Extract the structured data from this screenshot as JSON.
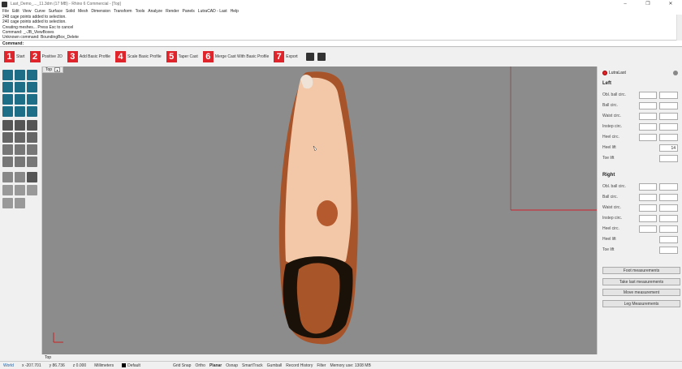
{
  "window": {
    "title": "Last_Demo_..._11.3dm (17 MB) - Rhino 6 Commercial - [Top]",
    "controls": [
      "–",
      "❐",
      "✕"
    ]
  },
  "menu": [
    "File",
    "Edit",
    "View",
    "Curve",
    "Surface",
    "Solid",
    "Mesh",
    "Dimension",
    "Transform",
    "Tools",
    "Analyze",
    "Render",
    "Panels",
    "LutraCAD - Last",
    "Help"
  ],
  "command_history": [
    "248 cage points added to selection.",
    "240 cage points added to selection.",
    "Creating meshes... Press Esc to cancel",
    "Command: _-JB_ViewBoxes",
    "Unknown command: BoundingBox_Delete"
  ],
  "command_prompt": "Command:",
  "steps": [
    {
      "num": "1",
      "label": "Start"
    },
    {
      "num": "2",
      "label": "Positive 2D"
    },
    {
      "num": "3",
      "label": "Add Basic Profile"
    },
    {
      "num": "4",
      "label": "Scale Basic Profile"
    },
    {
      "num": "5",
      "label": "Taper Cast"
    },
    {
      "num": "6",
      "label": "Merge Cast With Basic Profile"
    },
    {
      "num": "7",
      "label": "Export"
    }
  ],
  "viewport": {
    "name": "Top",
    "caret": "▾",
    "bottom_tab": "Top",
    "colors": {
      "background": "#8c8c8c",
      "model": "#f2c8a8",
      "red_axis": "#d0202a"
    }
  },
  "panel": {
    "title": "LutraLast",
    "left_header": "Left",
    "right_header": "Right",
    "left_rows": [
      {
        "label": "Obl. ball circ.",
        "a": "",
        "b": "",
        "two": true
      },
      {
        "label": "Ball circ.",
        "a": "",
        "b": "",
        "two": true
      },
      {
        "label": "Waist circ.",
        "a": "",
        "b": "",
        "two": true
      },
      {
        "label": "Instep circ.",
        "a": "",
        "b": "",
        "two": true
      },
      {
        "label": "Heel circ.",
        "a": "",
        "b": "",
        "two": true
      },
      {
        "label": "Heel lift",
        "a": "",
        "b": "14",
        "two": false
      },
      {
        "label": "Toe lift",
        "a": "",
        "b": "",
        "two": false
      }
    ],
    "right_rows": [
      {
        "label": "Obl. ball circ.",
        "a": "",
        "b": "",
        "two": true
      },
      {
        "label": "Ball circ.",
        "a": "",
        "b": "",
        "two": true
      },
      {
        "label": "Waist circ.",
        "a": "",
        "b": "",
        "two": true
      },
      {
        "label": "Instep circ.",
        "a": "",
        "b": "",
        "two": true
      },
      {
        "label": "Heel circ.",
        "a": "",
        "b": "",
        "two": true
      },
      {
        "label": "Heel lift",
        "a": "",
        "b": "",
        "two": false
      },
      {
        "label": "Toe lift",
        "a": "",
        "b": "",
        "two": false
      }
    ],
    "buttons": [
      "Foot measurements",
      "Take last measurements",
      "Move measurement",
      "Leg Measurements"
    ]
  },
  "status": {
    "cplane": "World",
    "x": "x -207.701",
    "y": "y 86.736",
    "z": "z 0.000",
    "units": "Millimeters",
    "layer": "Default",
    "toggles": [
      "Grid Snap",
      "Ortho",
      "Planar",
      "Osnap",
      "SmartTrack",
      "Gumball",
      "Record History",
      "Filter"
    ],
    "active_toggle": "Planar",
    "memory": "Memory use: 1308 MB"
  }
}
